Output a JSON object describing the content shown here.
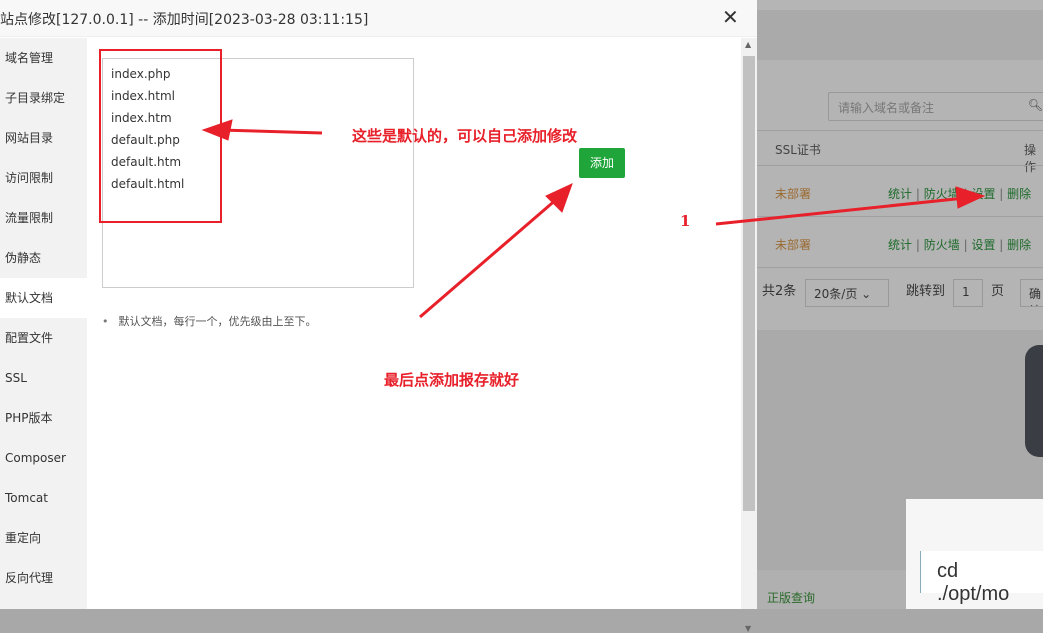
{
  "dialog": {
    "title": "站点修改[127.0.0.1] -- 添加时间[2023-03-28 03:11:15]",
    "close": "✕",
    "sidebar": [
      "域名管理",
      "子目录绑定",
      "网站目录",
      "访问限制",
      "流量限制",
      "伪静态",
      "默认文档",
      "配置文件",
      "SSL",
      "PHP版本",
      "Composer",
      "Tomcat",
      "重定向",
      "反向代理"
    ],
    "active_item": "默认文档",
    "default_docs": [
      "index.php",
      "index.html",
      "index.htm",
      "default.php",
      "default.htm",
      "default.html"
    ],
    "add_label": "添加",
    "tip": "默认文档，每行一个，优先级由上至下。"
  },
  "annotations": {
    "note1": "这些是默认的，可以自己添加修改",
    "note2": "最后点添加报存就好",
    "step": "1",
    "color": "#e8202a"
  },
  "background": {
    "search_placeholder": "请输入域名或备注",
    "headers": {
      "ssl": "SSL证书",
      "ops": "操作"
    },
    "rows": [
      {
        "ssl": "未部署",
        "ops": [
          "统计",
          "防火墙",
          "设置",
          "删除"
        ]
      },
      {
        "ssl": "未部署",
        "ops": [
          "统计",
          "防火墙",
          "设置",
          "删除"
        ]
      }
    ],
    "pager": {
      "total": "共2条",
      "per_page": "20条/页",
      "jump": "跳转到",
      "page": "1",
      "page_unit": "页",
      "confirm": "确认"
    },
    "footer_link": "正版查询",
    "terminal_cmd": "cd ./opt/mo"
  }
}
